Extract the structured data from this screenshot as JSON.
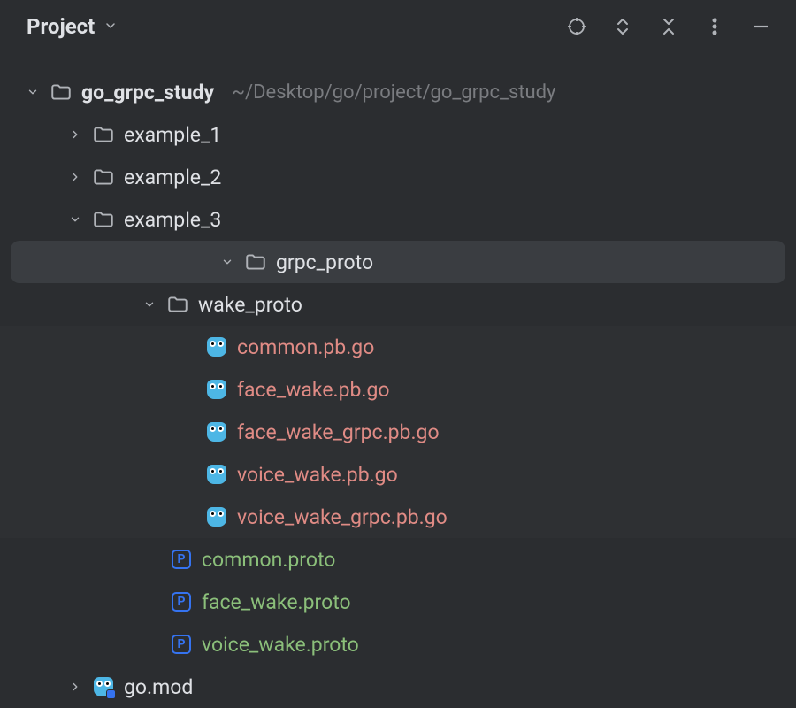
{
  "header": {
    "title": "Project"
  },
  "tree": {
    "root": {
      "name": "go_grpc_study",
      "path": "~/Desktop/go/project/go_grpc_study"
    },
    "example_1": "example_1",
    "example_2": "example_2",
    "example_3": "example_3",
    "grpc_proto": "grpc_proto",
    "wake_proto": "wake_proto",
    "files": {
      "common_pb": "common.pb.go",
      "face_wake_pb": "face_wake.pb.go",
      "face_wake_grpc_pb": "face_wake_grpc.pb.go",
      "voice_wake_pb": "voice_wake.pb.go",
      "voice_wake_grpc_pb": "voice_wake_grpc.pb.go",
      "common_proto": "common.proto",
      "face_wake_proto": "face_wake.proto",
      "voice_wake_proto": "voice_wake.proto",
      "go_mod": "go.mod"
    },
    "proto_icon_letter": "P"
  }
}
